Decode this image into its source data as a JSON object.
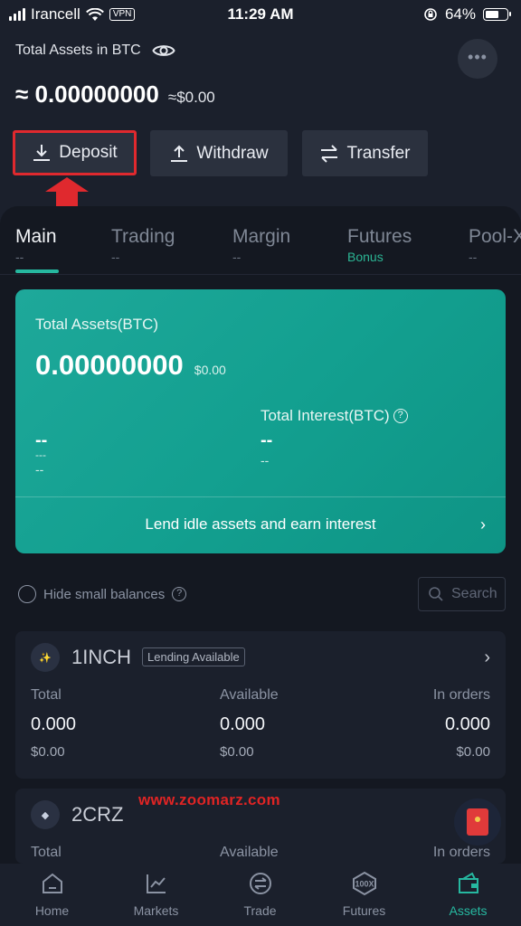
{
  "status_bar": {
    "carrier": "Irancell",
    "vpn": "VPN",
    "time": "11:29 AM",
    "battery": "64%",
    "battery_level": 0.64
  },
  "header": {
    "title": "Total Assets in BTC",
    "more": "•••",
    "balance_btc": "≈ 0.00000000",
    "balance_usd": "≈$0.00"
  },
  "actions": {
    "deposit": "Deposit",
    "withdraw": "Withdraw",
    "transfer": "Transfer"
  },
  "tabs": [
    {
      "label": "Main",
      "sub": "--"
    },
    {
      "label": "Trading",
      "sub": "--"
    },
    {
      "label": "Margin",
      "sub": "--"
    },
    {
      "label": "Futures",
      "sub": "Bonus"
    },
    {
      "label": "Pool-X",
      "sub": "--"
    }
  ],
  "summary_card": {
    "title": "Total Assets(BTC)",
    "value": "0.00000000",
    "usd": "$0.00",
    "interest_title": "Total Interest(BTC)",
    "left_dash_1": "--",
    "left_dash_2": "---",
    "left_dash_3": "--",
    "right_dash_1": "--",
    "right_dash_2": "--",
    "lend_text": "Lend idle assets and earn interest"
  },
  "filters": {
    "hide_small": "Hide small balances",
    "search_placeholder": "Search"
  },
  "assets": [
    {
      "symbol": "1INCH",
      "badge": "Lending Available",
      "labels": {
        "total": "Total",
        "available": "Available",
        "in_orders": "In orders"
      },
      "total": "0.000",
      "total_usd": "$0.00",
      "available": "0.000",
      "available_usd": "$0.00",
      "in_orders": "0.000",
      "in_orders_usd": "$0.00"
    },
    {
      "symbol": "2CRZ",
      "labels": {
        "total": "Total",
        "available": "Available",
        "in_orders": "In orders"
      }
    }
  ],
  "watermark": "www.zoomarz.com",
  "bottom_nav": [
    {
      "label": "Home",
      "icon": "home-icon"
    },
    {
      "label": "Markets",
      "icon": "chart-icon"
    },
    {
      "label": "Trade",
      "icon": "trade-icon"
    },
    {
      "label": "Futures",
      "icon": "futures-100x-icon"
    },
    {
      "label": "Assets",
      "icon": "wallet-icon"
    }
  ],
  "colors": {
    "accent": "#26b8a0",
    "highlight": "#e0292e",
    "background": "#141821"
  }
}
